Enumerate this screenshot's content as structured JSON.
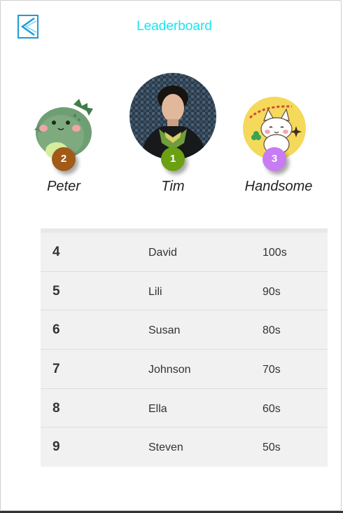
{
  "header": {
    "title": "Leaderboard"
  },
  "podium": [
    {
      "rank": "2",
      "name": "Peter",
      "badge_color": "#a15a17",
      "avatar": "green-dinosaur-avatar"
    },
    {
      "rank": "1",
      "name": "Tim",
      "badge_color": "#6aa012",
      "avatar": "person-photo-avatar"
    },
    {
      "rank": "3",
      "name": "Handsome",
      "badge_color": "#c87cf2",
      "avatar": "white-cat-avatar"
    }
  ],
  "leaderboard": [
    {
      "rank": "4",
      "name": "David",
      "score": "100s"
    },
    {
      "rank": "5",
      "name": "Lili",
      "score": "90s"
    },
    {
      "rank": "6",
      "name": "Susan",
      "score": "80s"
    },
    {
      "rank": "7",
      "name": "Johnson",
      "score": "70s"
    },
    {
      "rank": "8",
      "name": "Ella",
      "score": "60s"
    },
    {
      "rank": "9",
      "name": "Steven",
      "score": "50s"
    }
  ],
  "colors": {
    "title": "#19e6f0",
    "back_icon": "#1e9bd7",
    "table_bg": "#f1f1f1"
  }
}
